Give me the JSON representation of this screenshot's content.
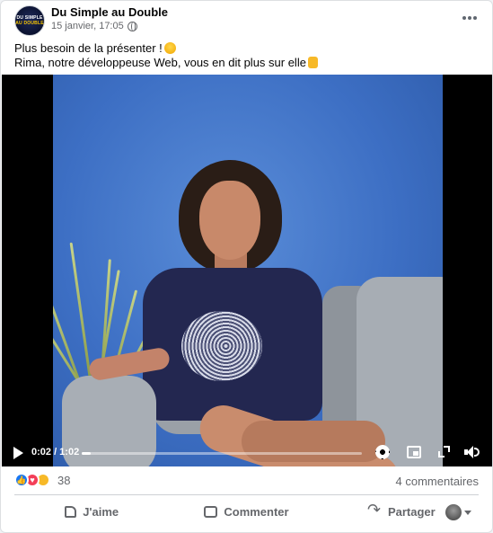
{
  "post": {
    "page_name": "Du Simple au Double",
    "timestamp": "15 janvier, 17:05",
    "avatar_text": [
      "DU SIMPLE",
      "AU DOUBLE"
    ],
    "text_line1": "Plus besoin de la présenter !",
    "text_line2": "Rima, notre développeuse Web, vous en dit plus sur elle"
  },
  "video": {
    "time_display": "0:02 / 1:02",
    "progress_fraction": 0.032
  },
  "stats": {
    "reaction_count": "38",
    "comments": "4 commentaires"
  },
  "actions": {
    "like": "J'aime",
    "comment": "Commenter",
    "share": "Partager"
  },
  "colors": {
    "accent": "#1877f2",
    "love": "#f33e58",
    "haha": "#f7b928",
    "muted_text": "#65676b"
  }
}
